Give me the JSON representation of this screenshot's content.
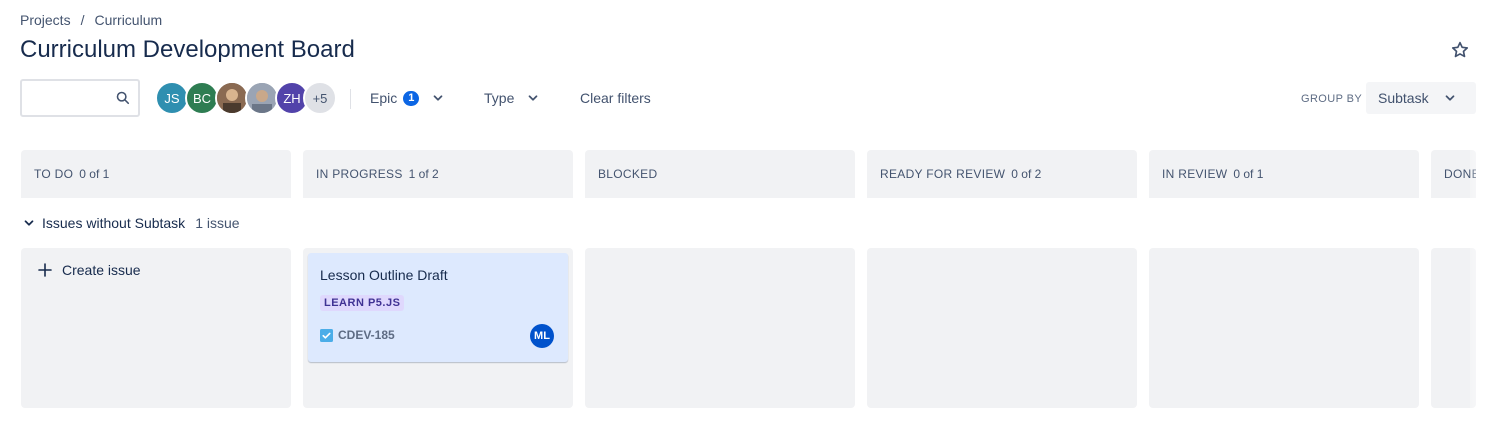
{
  "breadcrumb": {
    "projects": "Projects",
    "separator": "/",
    "current": "Curriculum"
  },
  "page": {
    "title": "Curriculum Development Board"
  },
  "search": {
    "value": "",
    "placeholder": ""
  },
  "avatars": [
    {
      "initials": "JS",
      "color": "#2f8fb0"
    },
    {
      "initials": "BC",
      "color": "#2e7d52"
    },
    {
      "initials": "",
      "color": "#8a6a52",
      "kind": "photo"
    },
    {
      "initials": "",
      "color": "#9aa4b4",
      "kind": "photo"
    },
    {
      "initials": "ZH",
      "color": "#5243aa"
    }
  ],
  "avatars_more": "+5",
  "filters": {
    "epic_label": "Epic",
    "epic_badge": "1",
    "type_label": "Type",
    "clear_label": "Clear filters"
  },
  "group_by": {
    "label": "GROUP BY",
    "value": "Subtask"
  },
  "columns": [
    {
      "name": "TO DO",
      "count": "0 of 1"
    },
    {
      "name": "IN PROGRESS",
      "count": "1 of 2"
    },
    {
      "name": "BLOCKED",
      "count": ""
    },
    {
      "name": "READY FOR REVIEW",
      "count": "0 of 2"
    },
    {
      "name": "IN REVIEW",
      "count": "0 of 1"
    },
    {
      "name": "DONE",
      "count": ""
    }
  ],
  "swimlane": {
    "label": "Issues without Subtask",
    "count": "1 issue"
  },
  "create_issue": "Create issue",
  "card": {
    "title": "Lesson Outline Draft",
    "epic": "LEARN P5.JS",
    "epic_color": "#dfd8fd",
    "key": "CDEV-185",
    "assignee": "ML"
  },
  "colors": {
    "accent": "#0c66e4",
    "column_bg": "#f1f2f4",
    "card_bg": "#dde9fe"
  }
}
